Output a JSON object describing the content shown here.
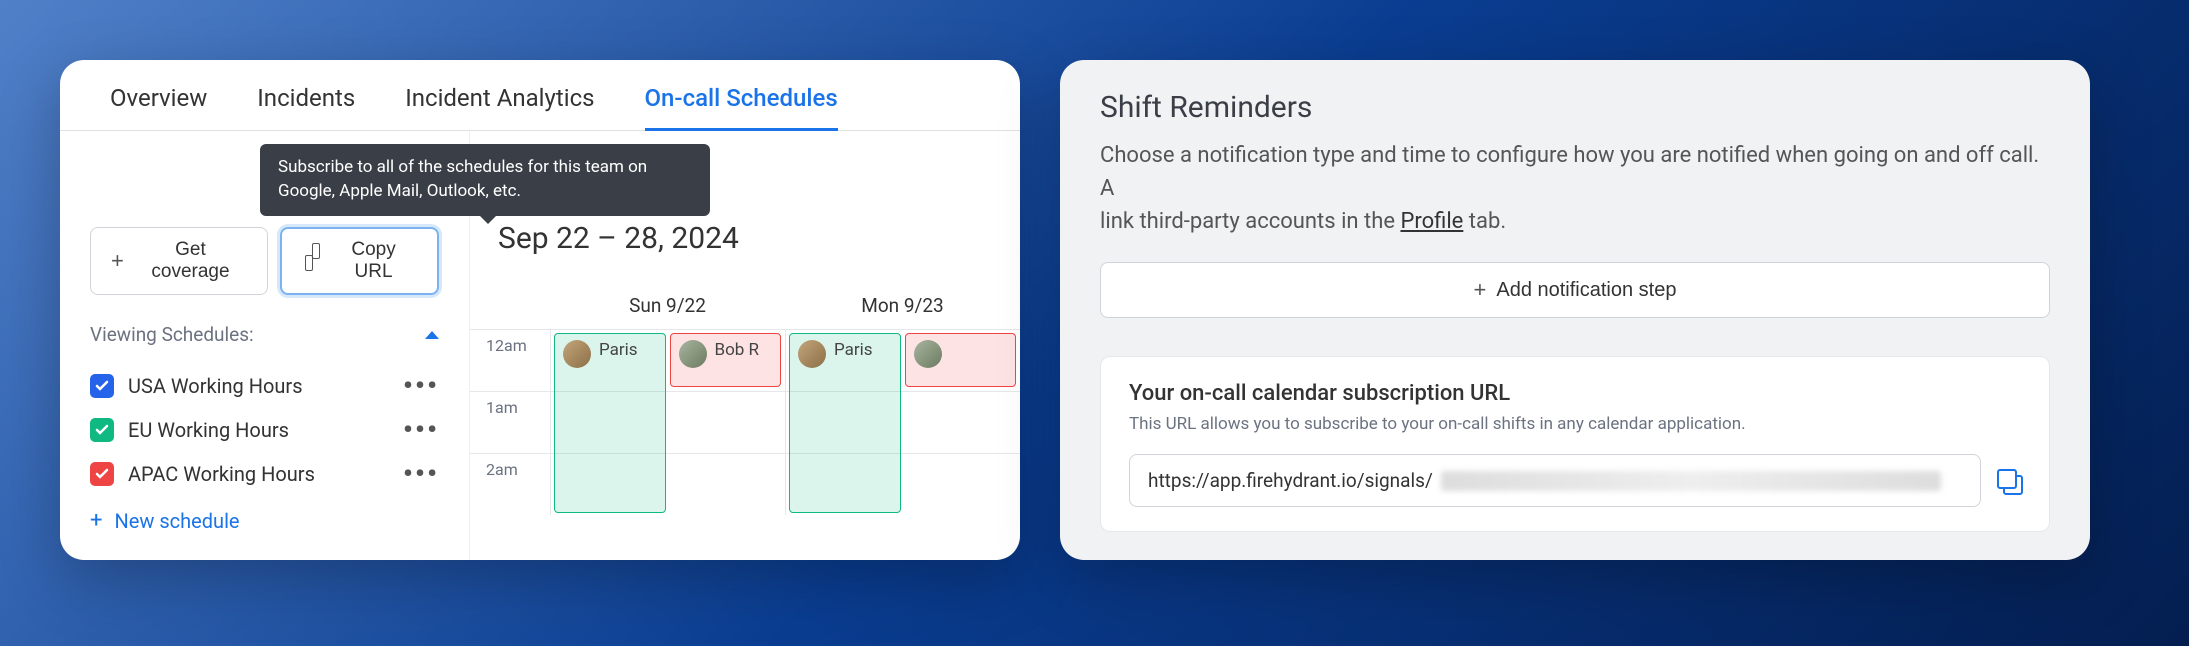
{
  "left": {
    "tabs": [
      "Overview",
      "Incidents",
      "Incident Analytics",
      "On-call Schedules"
    ],
    "active_tab": "On-call Schedules",
    "tooltip": "Subscribe to all of the schedules for this team on Google, Apple Mail, Outlook, etc.",
    "buttons": {
      "get_coverage": "Get coverage",
      "copy_url": "Copy URL"
    },
    "viewing_label": "Viewing Schedules:",
    "schedules": [
      {
        "label": "USA Working Hours",
        "color": "blue"
      },
      {
        "label": "EU Working Hours",
        "color": "green"
      },
      {
        "label": "APAC Working Hours",
        "color": "red"
      }
    ],
    "new_schedule": "New schedule",
    "date_range": "Sep 22 – 28, 2024",
    "days": [
      "Sun 9/22",
      "Mon 9/23"
    ],
    "times": [
      "12am",
      "1am",
      "2am"
    ],
    "shifts": {
      "paris": "Paris",
      "bob": "Bob R"
    }
  },
  "right": {
    "title": "Shift Reminders",
    "description_a": "Choose a notification type and time to configure how you are notified when going on and off call. A",
    "description_b": "link third-party accounts in the ",
    "profile_link": "Profile",
    "description_c": " tab.",
    "add_step": "Add notification step",
    "url_title": "Your on-call calendar subscription URL",
    "url_desc": "This URL allows you to subscribe to your on-call shifts in any calendar application.",
    "url_value": "https://app.firehydrant.io/signals/"
  }
}
